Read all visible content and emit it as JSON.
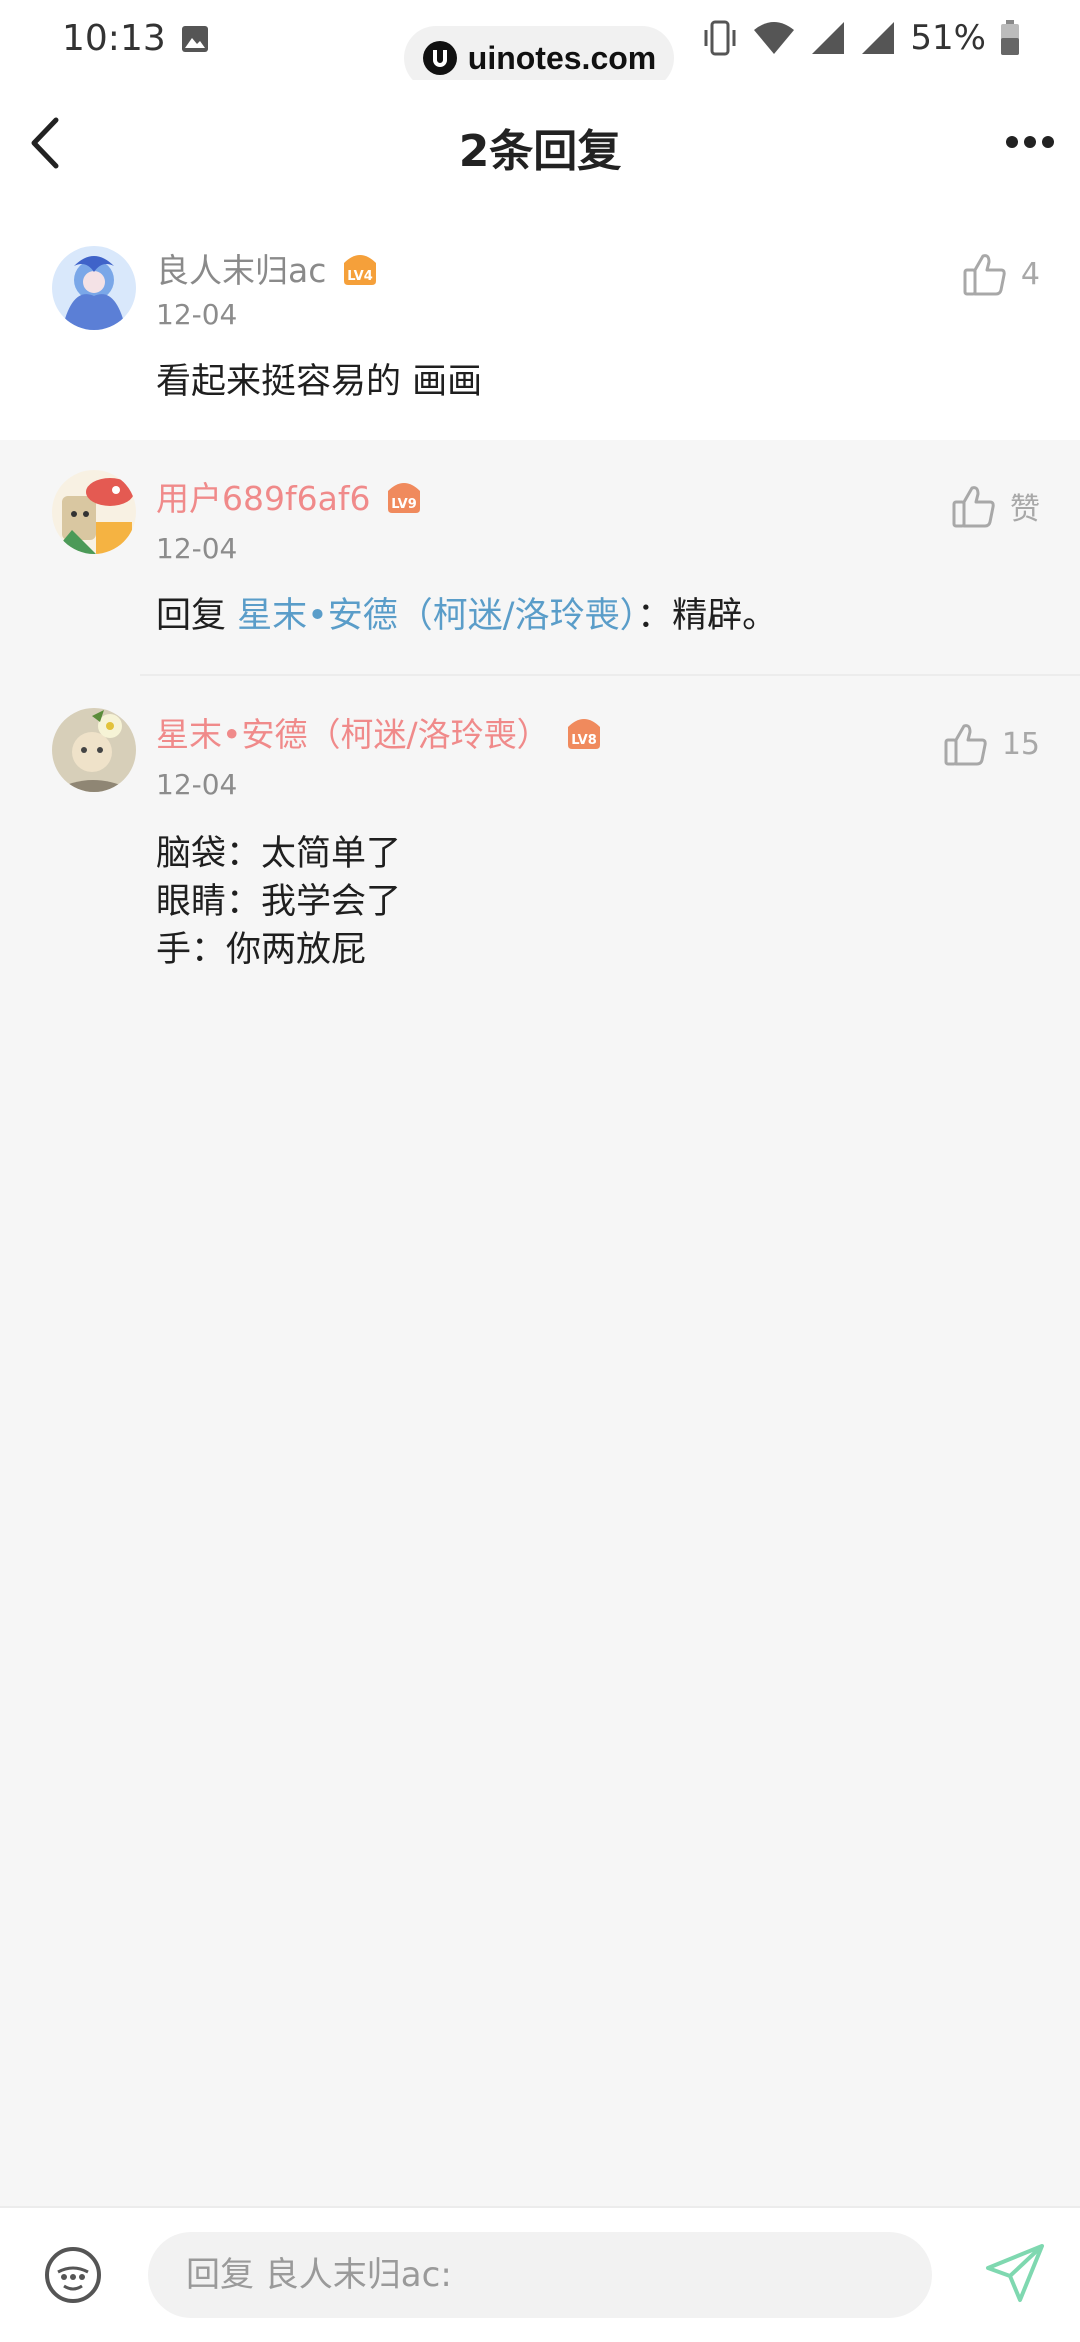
{
  "status_bar": {
    "time": "10:13",
    "watermark": "uinotes.com",
    "battery": "51%"
  },
  "header": {
    "title": "2条回复"
  },
  "comments": [
    {
      "username": "良人末归ac",
      "level": "LV4",
      "date": "12-04",
      "text": "看起来挺容易的 画画",
      "likes": "4"
    },
    {
      "username": "用户689f6af6",
      "level": "LV9",
      "date": "12-04",
      "reply_prefix": "回复",
      "mention": "星末•安德（柯迷/洛玲喪）",
      "reply_suffix": "：精辟。",
      "likes": "赞"
    },
    {
      "username": "星末•安德（柯迷/洛玲喪）",
      "level": "LV8",
      "date": "12-04",
      "lines": [
        "脑袋：太简单了",
        "眼睛：我学会了",
        "手：你两放屁"
      ],
      "likes": "15"
    }
  ],
  "bottom_bar": {
    "placeholder": "回复 良人末归ac:"
  },
  "colors": {
    "mention": "#5a9dc9",
    "username_pink": "#f08a8a",
    "badge_orange": "#f5a03a",
    "send_green": "#7fd8b0"
  }
}
